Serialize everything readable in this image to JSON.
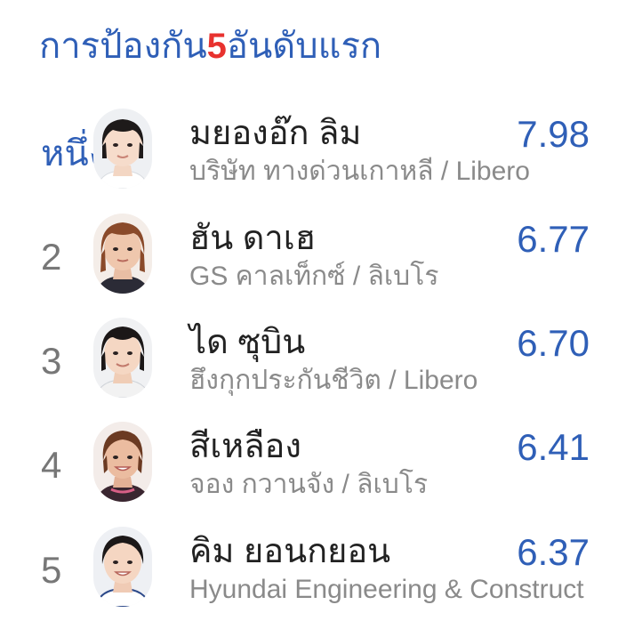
{
  "header": {
    "title_before": "การป้องกัน",
    "title_number": "5",
    "title_after": "อันดับแรก"
  },
  "colors": {
    "accent": "#2f5fb7",
    "highlight": "#e8322f",
    "name_text": "#222222",
    "secondary_text": "#8a8a8a",
    "rank_text": "#777777"
  },
  "players": [
    {
      "rank": "หนึ่ง",
      "name": "มยองอ๊ก ลิม",
      "team_position": "บริษัท ทางด่วนเกาหลี / Libero",
      "score": "7.98",
      "avatar_icon": "player-photo-icon"
    },
    {
      "rank": "2",
      "name": "ฮัน ดาเฮ",
      "team_position": "GS คาลเท็กซ์ / ลิเบโร",
      "score": "6.77",
      "avatar_icon": "player-photo-icon"
    },
    {
      "rank": "3",
      "name": "ได ซุบิน",
      "team_position": "ฮึงกุกประกันชีวิต / Libero",
      "score": "6.70",
      "avatar_icon": "player-photo-icon"
    },
    {
      "rank": "4",
      "name": "สีเหลือง",
      "team_position": "จอง กวานจัง / ลิเบโร",
      "score": "6.41",
      "avatar_icon": "player-photo-icon"
    },
    {
      "rank": "5",
      "name": "คิม ยอนกยอน",
      "team_position": "Hyundai Engineering & Construct",
      "score": "6.37",
      "avatar_icon": "player-photo-icon"
    }
  ]
}
